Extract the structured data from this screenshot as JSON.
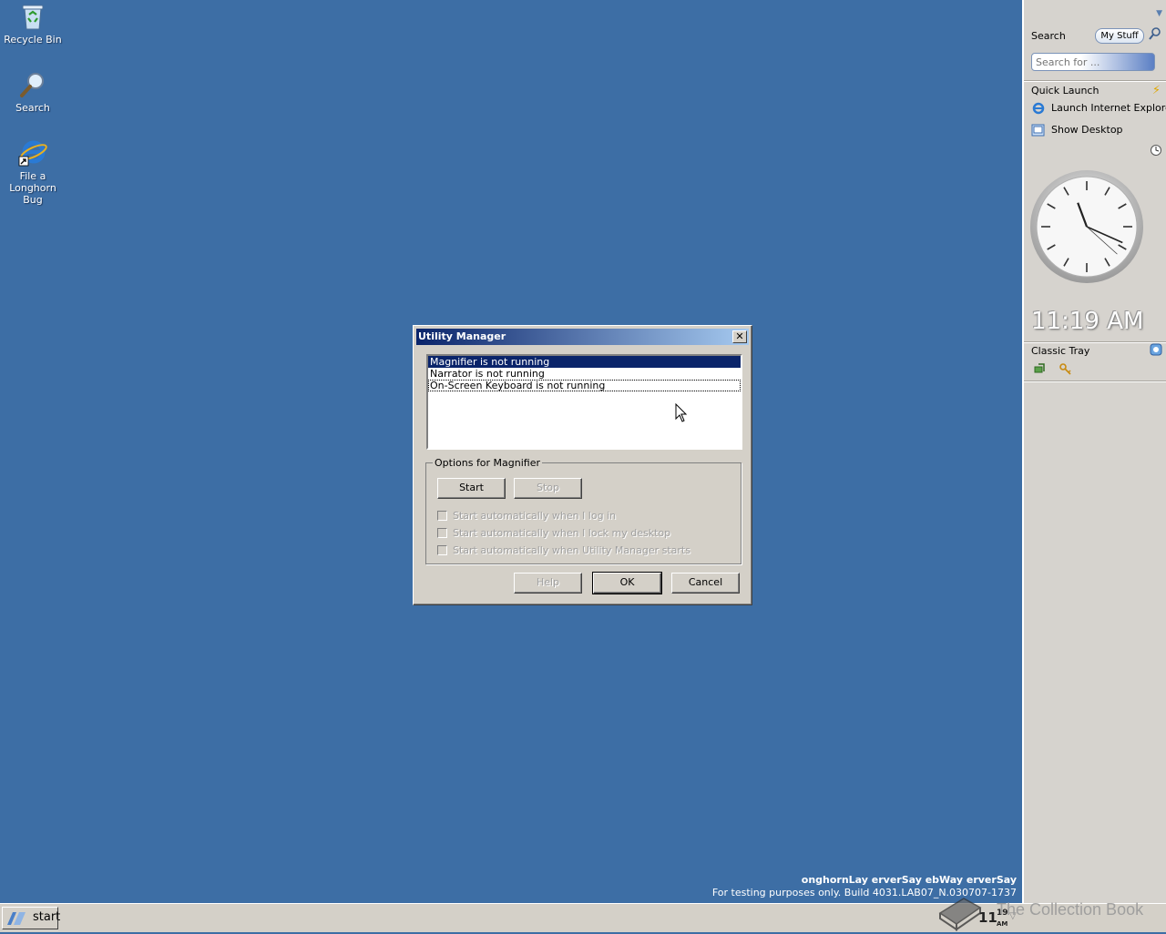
{
  "desktop": {
    "icons": [
      {
        "label": "Recycle Bin"
      },
      {
        "label": "Search"
      },
      {
        "label": "File a\nLonghorn Bug"
      }
    ],
    "watermark": {
      "line1": "onghornLay erverSay ebWay erverSay",
      "line2": "For testing purposes only. Build 4031.LAB07_N.030707-1737"
    }
  },
  "sidebar": {
    "search": {
      "title": "Search",
      "my_stuff_label": "My Stuff",
      "placeholder": "Search for ..."
    },
    "quick_launch": {
      "title": "Quick Launch",
      "items": [
        {
          "label": "Launch Internet Explorer"
        },
        {
          "label": "Show Desktop"
        }
      ]
    },
    "clock": {
      "time_text": "11:19 AM",
      "hour": 11,
      "minute": 19,
      "second": 22
    },
    "classic_tray": {
      "title": "Classic Tray"
    }
  },
  "dialog": {
    "title": "Utility Manager",
    "close_label": "✕",
    "list_items": [
      {
        "label": "Magnifier is not running",
        "selected": true
      },
      {
        "label": "Narrator is not running",
        "selected": false
      },
      {
        "label": "On-Screen Keyboard is not running",
        "selected": false,
        "focused": true
      }
    ],
    "options_group": {
      "legend": "Options for Magnifier",
      "start_label": "Start",
      "stop_label": "Stop",
      "checkboxes": [
        {
          "label": "Start automatically when I log in",
          "checked": false
        },
        {
          "label": "Start automatically when I lock my desktop",
          "checked": false
        },
        {
          "label": "Start automatically when Utility Manager starts",
          "checked": false
        }
      ]
    },
    "buttons": {
      "help_label": "Help",
      "ok_label": "OK",
      "cancel_label": "Cancel"
    }
  },
  "taskbar": {
    "start_label": "start",
    "tray_clock": "11",
    "tray_clock_small": "19",
    "tray_clock_ampm": "AM",
    "overlay_text": "The Collection Book"
  },
  "colors": {
    "desktop": "#3d6ea5",
    "titlebar_start": "#0a246a",
    "titlebar_end": "#a6caf0",
    "selection": "#0a246a"
  }
}
